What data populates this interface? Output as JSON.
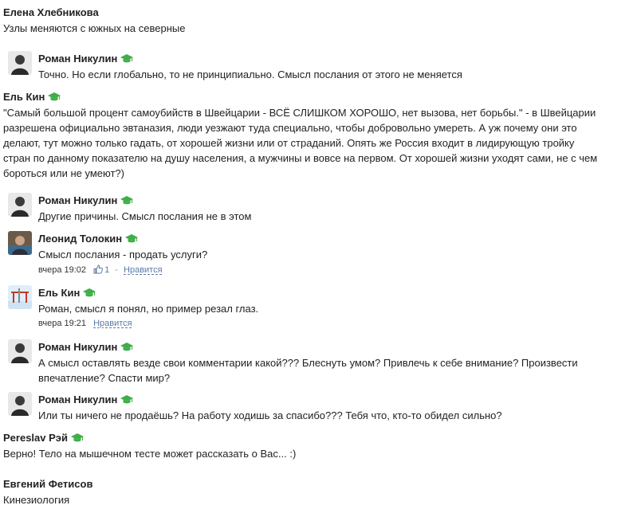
{
  "colors": {
    "cap_green": "#3fae49",
    "link_blue": "#5a7aa8",
    "text": "#222222"
  },
  "icons": {
    "cap": "graduation-cap-icon",
    "like": "thumbs-up-icon"
  },
  "comments": [
    {
      "author": "Елена Хлебникова",
      "lines": [
        "Узлы меняются с южных на северные"
      ]
    },
    {
      "author": "Роман Никулин",
      "lines": [
        "Точно. Но если глобально, то не принципиально. Смысл послания от этого не меняется"
      ]
    },
    {
      "author": "Ель Кин",
      "lines": [
        "\"Самый большой процент самоубийств в Швейцарии - ВСЁ СЛИШКОМ ХОРОШО, нет вызова, нет борьбы.\" - в Швейцарии",
        "разрешена официально эвтаназия, люди уезжают туда специально, чтобы добровольно умереть. А уж почему они это",
        "делают, тут можно только гадать, от хорошей жизни или от страданий. Опять же Россия входит в лидирующую тройку",
        "стран по данному показателю на душу населения, а мужчины и вовсе на первом. От хорошей жизни уходят сами, не с чем",
        "бороться или не умеют?)"
      ]
    },
    {
      "author": "Роман Никулин",
      "lines": [
        "Другие причины. Смысл послания не в этом"
      ]
    },
    {
      "author": "Леонид Толокин",
      "lines": [
        "Смысл послания - продать услуги?"
      ],
      "time": "вчера 19:02",
      "likes": "1",
      "like_label": "Нравится"
    },
    {
      "author": "Ель Кин",
      "lines": [
        "Роман, смысл я понял, но пример резал глаз."
      ],
      "time": "вчера 19:21",
      "like_label": "Нравится"
    },
    {
      "author": "Роман Никулин",
      "lines": [
        "А смысл оставлять везде свои комментарии какой??? Блеснуть умом? Привлечь к себе внимание? Произвести",
        "впечатление? Спасти мир?"
      ]
    },
    {
      "author": "Роман Никулин",
      "lines": [
        "Или ты ничего не продаёшь? На работу ходишь за спасибо??? Тебя что, кто-то обидел сильно?"
      ]
    },
    {
      "author": "Pereslav Рэй",
      "lines": [
        "Верно! Тело на мышечном тесте может рассказать о Вас... :)"
      ]
    },
    {
      "author": "Евгений Фетисов",
      "lines": [
        "Кинезиология"
      ]
    }
  ]
}
